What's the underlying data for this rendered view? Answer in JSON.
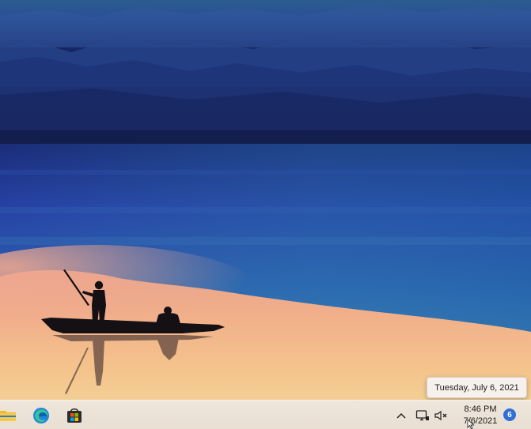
{
  "desktop": {
    "wallpaper_icon": "lake-boat-silhouette-wallpaper"
  },
  "taskbar": {
    "pinned": [
      {
        "name": "file-explorer-icon",
        "label": ""
      },
      {
        "name": "edge-icon",
        "label": ""
      },
      {
        "name": "microsoft-store-icon",
        "label": ""
      }
    ],
    "tray": {
      "show_hidden_icon": "chevron-up-icon",
      "network_icon": "network-icon",
      "volume_icon": "volume-muted-icon"
    },
    "clock": {
      "time": "8:46 PM",
      "date": "7/6/2021"
    },
    "notifications": {
      "count": "6"
    }
  },
  "tooltip": {
    "text": "Tuesday, July 6, 2021"
  },
  "colors": {
    "taskbar_bg": "#efe6dc",
    "badge": "#2f6fd6",
    "sky_top": "#1f3f7a",
    "lake": "#2a5fa8",
    "glow": "#f2b07a"
  }
}
